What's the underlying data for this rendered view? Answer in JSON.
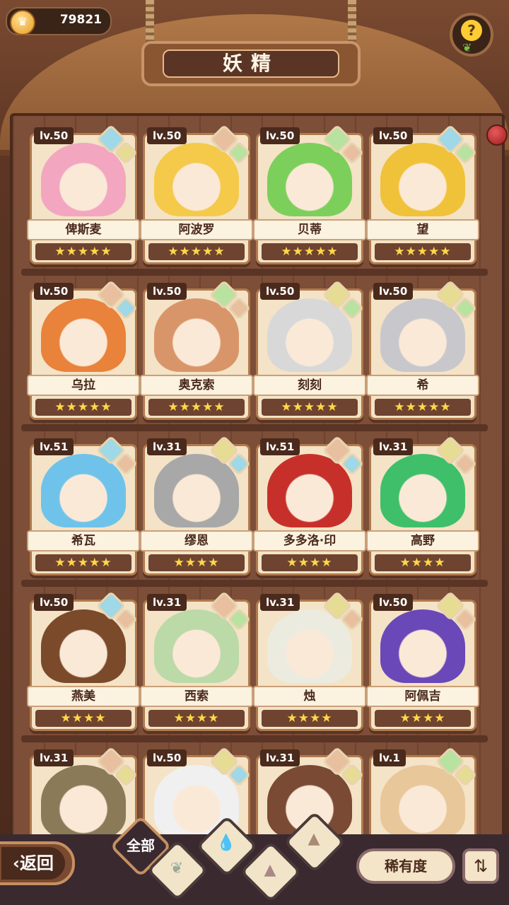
{
  "currency": {
    "icon": "crown-coin-icon",
    "value": "79821"
  },
  "title": "妖精",
  "help_icon": "question-sprout-icon",
  "fairies": [
    {
      "level": "lv.50",
      "name": "俾斯麦",
      "stars": 5,
      "elements": [
        "water",
        "earth"
      ],
      "color": "#f3a6c0"
    },
    {
      "level": "lv.50",
      "name": "阿波罗",
      "stars": 5,
      "elements": [
        "mountain",
        "leaf"
      ],
      "color": "#f5c94a"
    },
    {
      "level": "lv.50",
      "name": "贝蒂",
      "stars": 5,
      "elements": [
        "leaf",
        "mountain"
      ],
      "color": "#7ccf5a"
    },
    {
      "level": "lv.50",
      "name": "望",
      "stars": 5,
      "elements": [
        "water",
        "leaf"
      ],
      "color": "#f0c23a"
    },
    {
      "level": "lv.50",
      "name": "乌拉",
      "stars": 5,
      "elements": [
        "mountain",
        "water"
      ],
      "color": "#e9823a"
    },
    {
      "level": "lv.50",
      "name": "奥克索",
      "stars": 5,
      "elements": [
        "leaf",
        "mountain"
      ],
      "color": "#d9956a"
    },
    {
      "level": "lv.50",
      "name": "刻刻",
      "stars": 5,
      "elements": [
        "earth",
        "leaf"
      ],
      "color": "#d8d8d8"
    },
    {
      "level": "lv.50",
      "name": "希",
      "stars": 5,
      "elements": [
        "earth",
        "leaf"
      ],
      "color": "#c8c8cc"
    },
    {
      "level": "lv.51",
      "name": "希瓦",
      "stars": 5,
      "elements": [
        "water",
        "mountain"
      ],
      "color": "#6fc3ea"
    },
    {
      "level": "lv.31",
      "name": "缪恩",
      "stars": 4,
      "elements": [
        "earth",
        "water"
      ],
      "color": "#a8a8a8"
    },
    {
      "level": "lv.51",
      "name": "多多洛·印",
      "stars": 4,
      "elements": [
        "mountain",
        "water"
      ],
      "color": "#c7302a"
    },
    {
      "level": "lv.31",
      "name": "高野",
      "stars": 4,
      "elements": [
        "earth",
        "mountain"
      ],
      "color": "#3fbf6a"
    },
    {
      "level": "lv.50",
      "name": "燕美",
      "stars": 4,
      "elements": [
        "water",
        "mountain"
      ],
      "color": "#7a4a2a"
    },
    {
      "level": "lv.31",
      "name": "西索",
      "stars": 4,
      "elements": [
        "mountain",
        "leaf"
      ],
      "color": "#bcd9a8"
    },
    {
      "level": "lv.31",
      "name": "烛",
      "stars": 4,
      "elements": [
        "earth",
        "mountain"
      ],
      "color": "#ecebe0"
    },
    {
      "level": "lv.50",
      "name": "阿佩吉",
      "stars": 4,
      "elements": [
        "earth",
        "mountain"
      ],
      "color": "#6a48b8"
    },
    {
      "level": "lv.31",
      "name": "",
      "stars": 0,
      "elements": [
        "mountain",
        "earth"
      ],
      "color": "#8a7a58"
    },
    {
      "level": "lv.50",
      "name": "",
      "stars": 0,
      "elements": [
        "earth",
        "water"
      ],
      "color": "#f0f0f0"
    },
    {
      "level": "lv.31",
      "name": "",
      "stars": 0,
      "elements": [
        "mountain",
        "earth"
      ],
      "color": "#7a4a34"
    },
    {
      "level": "lv.1",
      "name": "",
      "stars": 0,
      "elements": [
        "leaf",
        "earth"
      ],
      "color": "#e8c79a"
    }
  ],
  "element_colors": {
    "water": "#9fd8e6",
    "earth": "#e7dc93",
    "leaf": "#b8e2a0",
    "mountain": "#e8c0a0"
  },
  "bottom": {
    "back_label": "返回",
    "filter_all_label": "全部",
    "rarity_label": "稀有度",
    "sort_icon": "sort-list-icon"
  }
}
